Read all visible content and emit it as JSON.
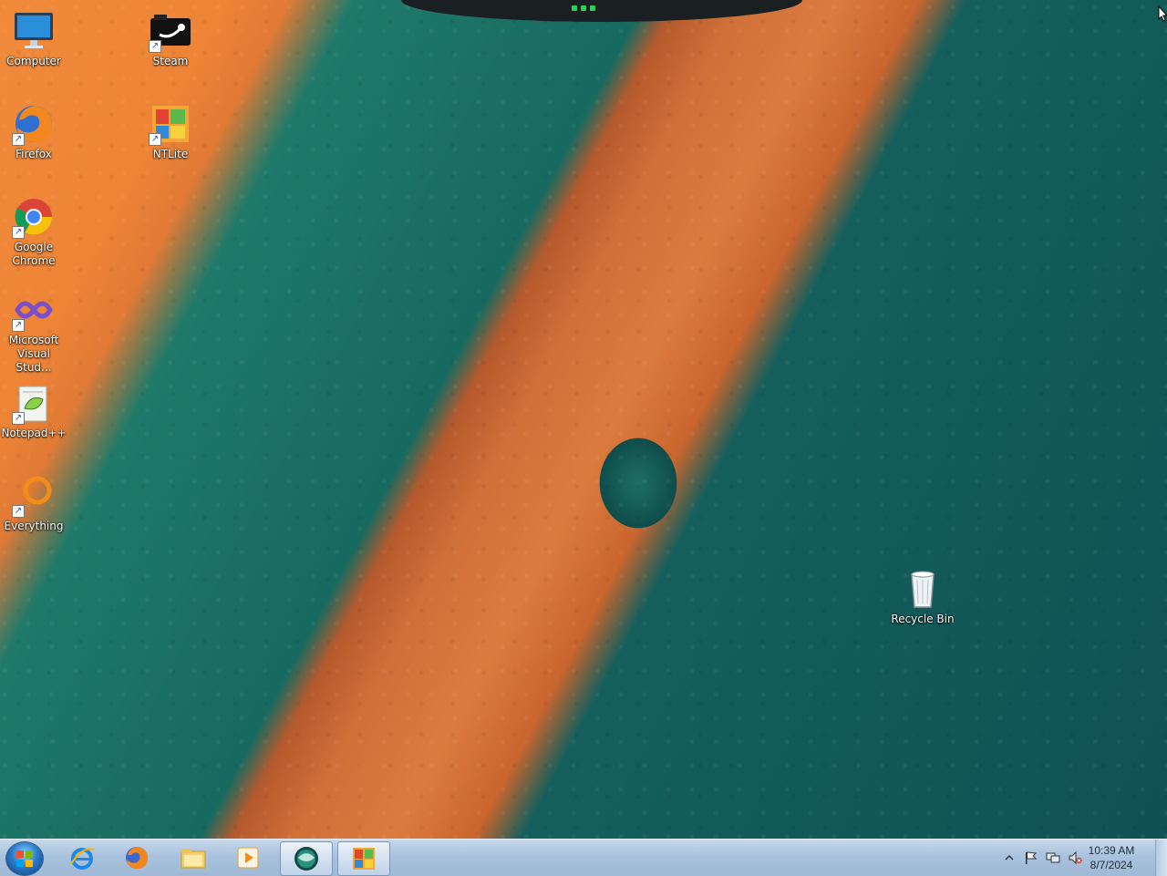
{
  "desktop_icons": [
    {
      "id": "computer",
      "label": "Computer"
    },
    {
      "id": "steam",
      "label": "Steam"
    },
    {
      "id": "firefox",
      "label": "Firefox"
    },
    {
      "id": "ntlite",
      "label": "NTLite"
    },
    {
      "id": "chrome",
      "label": "Google Chrome"
    },
    {
      "id": "visual-studio",
      "label": "Microsoft Visual Stud..."
    },
    {
      "id": "notepadpp",
      "label": "Notepad++"
    },
    {
      "id": "everything",
      "label": "Everything"
    },
    {
      "id": "recycle-bin",
      "label": "Recycle Bin"
    }
  ],
  "taskbar": {
    "pinned": [
      {
        "name": "internet-explorer-icon"
      },
      {
        "name": "firefox-icon"
      },
      {
        "name": "file-explorer-icon"
      },
      {
        "name": "media-player-icon"
      },
      {
        "name": "app-sphere-icon",
        "active": true
      },
      {
        "name": "ntlite-icon",
        "active": true
      }
    ],
    "tray_icons": [
      "show-hidden-icons-arrow",
      "action-center-flag-icon",
      "network-icon",
      "volume-muted-icon"
    ],
    "clock": {
      "time": "10:39 AM",
      "date": "8/7/2024"
    }
  },
  "colors": {
    "sand": "#e07a35",
    "sea": "#125a58",
    "taskbar": "#a9c2dd",
    "gadget_dots": "#2fd05a"
  }
}
